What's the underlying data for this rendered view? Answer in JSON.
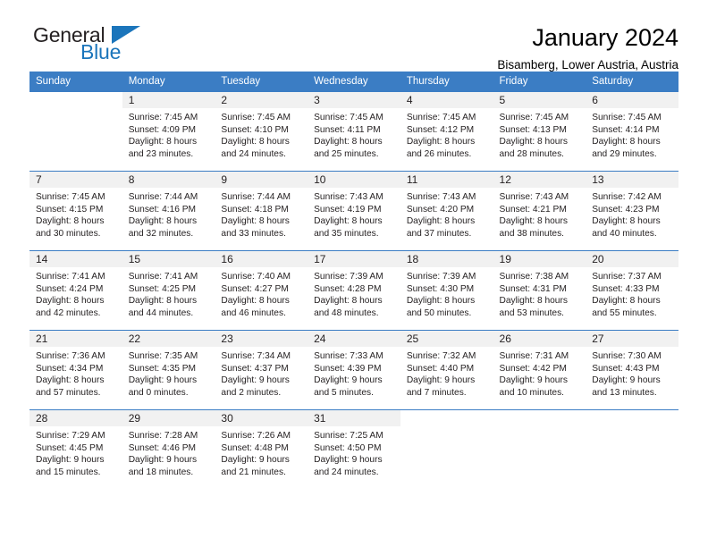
{
  "logo": {
    "word_one": "General",
    "word_two": "Blue",
    "triangle_icon": "triangle-icon",
    "brand_color": "#1b75bb",
    "text_color": "#231f20"
  },
  "header": {
    "title": "January 2024",
    "subtitle": "Bisamberg, Lower Austria, Austria"
  },
  "theme": {
    "header_bg": "#3b7dc4",
    "daynum_bg": "#f1f1f1",
    "grid_line": "#3b7dc4",
    "text": "#231f20"
  },
  "calendar": {
    "weekday_headers": [
      "Sunday",
      "Monday",
      "Tuesday",
      "Wednesday",
      "Thursday",
      "Friday",
      "Saturday"
    ],
    "labels": {
      "sunrise": "Sunrise:",
      "sunset": "Sunset:",
      "daylight": "Daylight:"
    },
    "weeks": [
      [
        {
          "day": "",
          "sunrise": "",
          "sunset": "",
          "daylight_line1": "",
          "daylight_line2": "",
          "empty": true
        },
        {
          "day": "1",
          "sunrise": "Sunrise: 7:45 AM",
          "sunset": "Sunset: 4:09 PM",
          "daylight_line1": "Daylight: 8 hours",
          "daylight_line2": "and 23 minutes.",
          "empty": false
        },
        {
          "day": "2",
          "sunrise": "Sunrise: 7:45 AM",
          "sunset": "Sunset: 4:10 PM",
          "daylight_line1": "Daylight: 8 hours",
          "daylight_line2": "and 24 minutes.",
          "empty": false
        },
        {
          "day": "3",
          "sunrise": "Sunrise: 7:45 AM",
          "sunset": "Sunset: 4:11 PM",
          "daylight_line1": "Daylight: 8 hours",
          "daylight_line2": "and 25 minutes.",
          "empty": false
        },
        {
          "day": "4",
          "sunrise": "Sunrise: 7:45 AM",
          "sunset": "Sunset: 4:12 PM",
          "daylight_line1": "Daylight: 8 hours",
          "daylight_line2": "and 26 minutes.",
          "empty": false
        },
        {
          "day": "5",
          "sunrise": "Sunrise: 7:45 AM",
          "sunset": "Sunset: 4:13 PM",
          "daylight_line1": "Daylight: 8 hours",
          "daylight_line2": "and 28 minutes.",
          "empty": false
        },
        {
          "day": "6",
          "sunrise": "Sunrise: 7:45 AM",
          "sunset": "Sunset: 4:14 PM",
          "daylight_line1": "Daylight: 8 hours",
          "daylight_line2": "and 29 minutes.",
          "empty": false
        }
      ],
      [
        {
          "day": "7",
          "sunrise": "Sunrise: 7:45 AM",
          "sunset": "Sunset: 4:15 PM",
          "daylight_line1": "Daylight: 8 hours",
          "daylight_line2": "and 30 minutes.",
          "empty": false
        },
        {
          "day": "8",
          "sunrise": "Sunrise: 7:44 AM",
          "sunset": "Sunset: 4:16 PM",
          "daylight_line1": "Daylight: 8 hours",
          "daylight_line2": "and 32 minutes.",
          "empty": false
        },
        {
          "day": "9",
          "sunrise": "Sunrise: 7:44 AM",
          "sunset": "Sunset: 4:18 PM",
          "daylight_line1": "Daylight: 8 hours",
          "daylight_line2": "and 33 minutes.",
          "empty": false
        },
        {
          "day": "10",
          "sunrise": "Sunrise: 7:43 AM",
          "sunset": "Sunset: 4:19 PM",
          "daylight_line1": "Daylight: 8 hours",
          "daylight_line2": "and 35 minutes.",
          "empty": false
        },
        {
          "day": "11",
          "sunrise": "Sunrise: 7:43 AM",
          "sunset": "Sunset: 4:20 PM",
          "daylight_line1": "Daylight: 8 hours",
          "daylight_line2": "and 37 minutes.",
          "empty": false
        },
        {
          "day": "12",
          "sunrise": "Sunrise: 7:43 AM",
          "sunset": "Sunset: 4:21 PM",
          "daylight_line1": "Daylight: 8 hours",
          "daylight_line2": "and 38 minutes.",
          "empty": false
        },
        {
          "day": "13",
          "sunrise": "Sunrise: 7:42 AM",
          "sunset": "Sunset: 4:23 PM",
          "daylight_line1": "Daylight: 8 hours",
          "daylight_line2": "and 40 minutes.",
          "empty": false
        }
      ],
      [
        {
          "day": "14",
          "sunrise": "Sunrise: 7:41 AM",
          "sunset": "Sunset: 4:24 PM",
          "daylight_line1": "Daylight: 8 hours",
          "daylight_line2": "and 42 minutes.",
          "empty": false
        },
        {
          "day": "15",
          "sunrise": "Sunrise: 7:41 AM",
          "sunset": "Sunset: 4:25 PM",
          "daylight_line1": "Daylight: 8 hours",
          "daylight_line2": "and 44 minutes.",
          "empty": false
        },
        {
          "day": "16",
          "sunrise": "Sunrise: 7:40 AM",
          "sunset": "Sunset: 4:27 PM",
          "daylight_line1": "Daylight: 8 hours",
          "daylight_line2": "and 46 minutes.",
          "empty": false
        },
        {
          "day": "17",
          "sunrise": "Sunrise: 7:39 AM",
          "sunset": "Sunset: 4:28 PM",
          "daylight_line1": "Daylight: 8 hours",
          "daylight_line2": "and 48 minutes.",
          "empty": false
        },
        {
          "day": "18",
          "sunrise": "Sunrise: 7:39 AM",
          "sunset": "Sunset: 4:30 PM",
          "daylight_line1": "Daylight: 8 hours",
          "daylight_line2": "and 50 minutes.",
          "empty": false
        },
        {
          "day": "19",
          "sunrise": "Sunrise: 7:38 AM",
          "sunset": "Sunset: 4:31 PM",
          "daylight_line1": "Daylight: 8 hours",
          "daylight_line2": "and 53 minutes.",
          "empty": false
        },
        {
          "day": "20",
          "sunrise": "Sunrise: 7:37 AM",
          "sunset": "Sunset: 4:33 PM",
          "daylight_line1": "Daylight: 8 hours",
          "daylight_line2": "and 55 minutes.",
          "empty": false
        }
      ],
      [
        {
          "day": "21",
          "sunrise": "Sunrise: 7:36 AM",
          "sunset": "Sunset: 4:34 PM",
          "daylight_line1": "Daylight: 8 hours",
          "daylight_line2": "and 57 minutes.",
          "empty": false
        },
        {
          "day": "22",
          "sunrise": "Sunrise: 7:35 AM",
          "sunset": "Sunset: 4:35 PM",
          "daylight_line1": "Daylight: 9 hours",
          "daylight_line2": "and 0 minutes.",
          "empty": false
        },
        {
          "day": "23",
          "sunrise": "Sunrise: 7:34 AM",
          "sunset": "Sunset: 4:37 PM",
          "daylight_line1": "Daylight: 9 hours",
          "daylight_line2": "and 2 minutes.",
          "empty": false
        },
        {
          "day": "24",
          "sunrise": "Sunrise: 7:33 AM",
          "sunset": "Sunset: 4:39 PM",
          "daylight_line1": "Daylight: 9 hours",
          "daylight_line2": "and 5 minutes.",
          "empty": false
        },
        {
          "day": "25",
          "sunrise": "Sunrise: 7:32 AM",
          "sunset": "Sunset: 4:40 PM",
          "daylight_line1": "Daylight: 9 hours",
          "daylight_line2": "and 7 minutes.",
          "empty": false
        },
        {
          "day": "26",
          "sunrise": "Sunrise: 7:31 AM",
          "sunset": "Sunset: 4:42 PM",
          "daylight_line1": "Daylight: 9 hours",
          "daylight_line2": "and 10 minutes.",
          "empty": false
        },
        {
          "day": "27",
          "sunrise": "Sunrise: 7:30 AM",
          "sunset": "Sunset: 4:43 PM",
          "daylight_line1": "Daylight: 9 hours",
          "daylight_line2": "and 13 minutes.",
          "empty": false
        }
      ],
      [
        {
          "day": "28",
          "sunrise": "Sunrise: 7:29 AM",
          "sunset": "Sunset: 4:45 PM",
          "daylight_line1": "Daylight: 9 hours",
          "daylight_line2": "and 15 minutes.",
          "empty": false
        },
        {
          "day": "29",
          "sunrise": "Sunrise: 7:28 AM",
          "sunset": "Sunset: 4:46 PM",
          "daylight_line1": "Daylight: 9 hours",
          "daylight_line2": "and 18 minutes.",
          "empty": false
        },
        {
          "day": "30",
          "sunrise": "Sunrise: 7:26 AM",
          "sunset": "Sunset: 4:48 PM",
          "daylight_line1": "Daylight: 9 hours",
          "daylight_line2": "and 21 minutes.",
          "empty": false
        },
        {
          "day": "31",
          "sunrise": "Sunrise: 7:25 AM",
          "sunset": "Sunset: 4:50 PM",
          "daylight_line1": "Daylight: 9 hours",
          "daylight_line2": "and 24 minutes.",
          "empty": false
        },
        {
          "day": "",
          "sunrise": "",
          "sunset": "",
          "daylight_line1": "",
          "daylight_line2": "",
          "empty": true
        },
        {
          "day": "",
          "sunrise": "",
          "sunset": "",
          "daylight_line1": "",
          "daylight_line2": "",
          "empty": true
        },
        {
          "day": "",
          "sunrise": "",
          "sunset": "",
          "daylight_line1": "",
          "daylight_line2": "",
          "empty": true
        }
      ]
    ]
  }
}
